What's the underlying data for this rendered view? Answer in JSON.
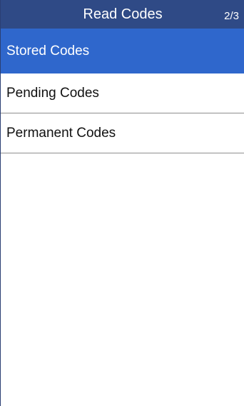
{
  "header": {
    "title": "Read Codes",
    "page_indicator": "2/3"
  },
  "menu": {
    "items": [
      {
        "label": "Stored Codes",
        "selected": true
      },
      {
        "label": "Pending Codes",
        "selected": false
      },
      {
        "label": "Permanent Codes",
        "selected": false
      }
    ]
  },
  "colors": {
    "header_background": "#2f4a86",
    "selected_background": "#2f67cc",
    "screen_background": "#ffffff"
  }
}
